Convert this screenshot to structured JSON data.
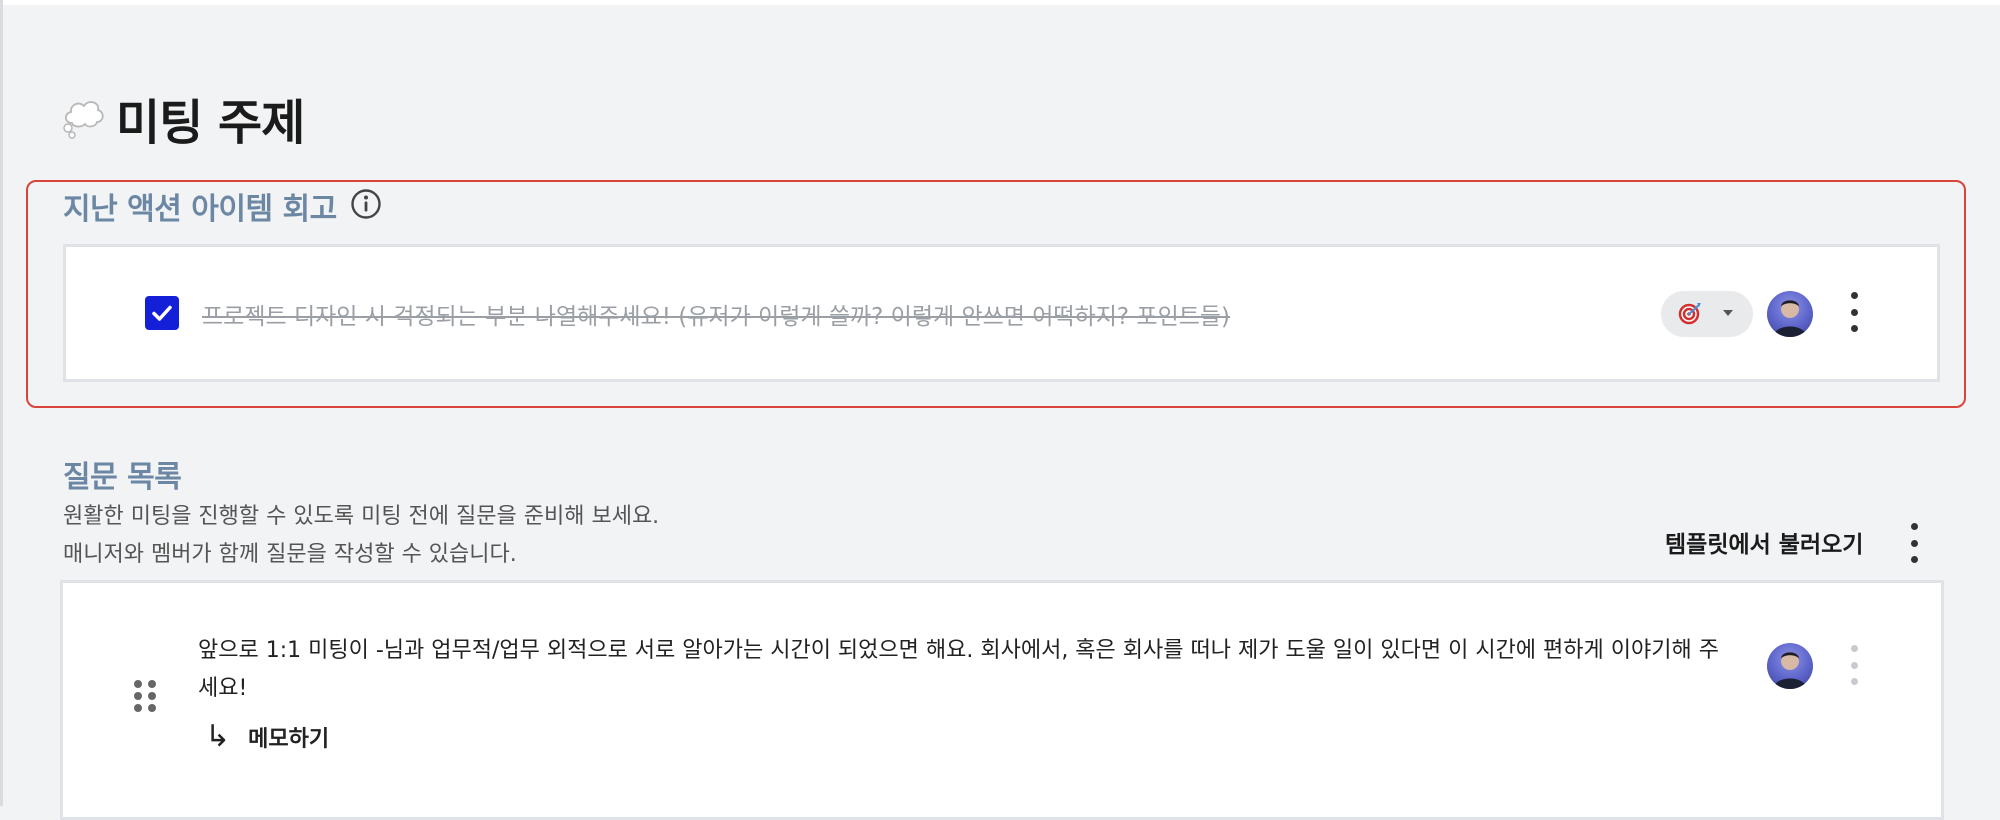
{
  "page": {
    "title": "미팅 주제",
    "title_icon": "thought-bubble-icon"
  },
  "last_action_items": {
    "heading": "지난 액션 아이템 회고",
    "item": {
      "checked": true,
      "text": "프로젝트  디자인 시 걱정되는 부분 나열해주세요! (유저가 이렇게 쓸까? 이렇게 안쓰면 어떡하지? 포인트들)",
      "category_icon": "target-dart-icon"
    }
  },
  "questions": {
    "heading": "질문 목록",
    "desc_line1": "원활한 미팅을 진행할 수 있도록 미팅 전에 질문을 준비해 보세요.",
    "desc_line2": "매니저와 멤버가 함께 질문을 작성할 수 있습니다.",
    "template_button": "템플릿에서 불러오기",
    "items": [
      {
        "text": "앞으로 1:1 미팅이 -님과 업무적/업무 외적으로 서로 알아가는 시간이 되었으면 해요.  회사에서, 혹은 회사를 떠나 제가 도울 일이 있다면 이 시간에 편하게 이야기해 주세요!",
        "memo_label": "메모하기",
        "memo_icon": "return-arrow"
      }
    ]
  },
  "colors": {
    "accent_red": "#d9453a",
    "checkbox_blue": "#1320d8",
    "section_heading": "#6b87a4"
  }
}
